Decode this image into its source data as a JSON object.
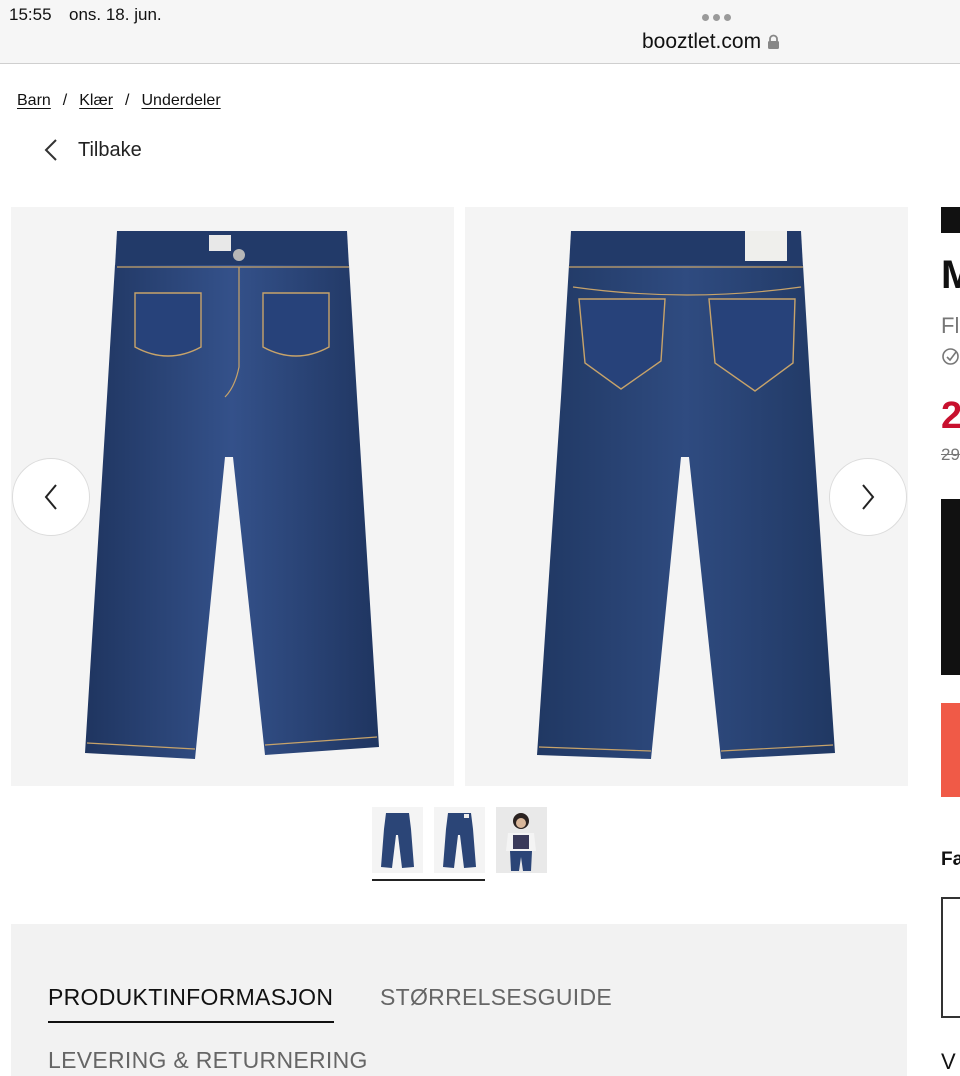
{
  "status_bar": {
    "time": "15:55",
    "date": "ons. 18. jun.",
    "url": "booztlet.com"
  },
  "breadcrumb": {
    "items": [
      "Barn",
      "Klær",
      "Underdeler"
    ],
    "separator": "/"
  },
  "back": {
    "label": "Tilbake"
  },
  "gallery": {
    "images": [
      "jeans-front",
      "jeans-back"
    ],
    "thumbnails": [
      "jeans-front-thumb",
      "jeans-back-thumb",
      "model-thumb"
    ],
    "prev_icon": "chevron-left-icon",
    "next_icon": "chevron-right-icon"
  },
  "info_tabs": {
    "produkt": "PRODUKTINFORMASJON",
    "storrelse": "STØRRELSESGUIDE",
    "levering": "LEVERING & RETURNERING"
  },
  "product_panel_clipped": {
    "title_visible": "M",
    "subtitle_visible": "Fl",
    "price_visible": "2",
    "old_price_visible": "29",
    "section_visible": "Fa",
    "bottom_visible": "V"
  },
  "colors": {
    "denim": "#2b4577",
    "denim_dark": "#1f3560",
    "stitch": "#c7a36a",
    "price_red": "#c8102e",
    "cta_coral": "#f05a47",
    "panel_bg": "#f4f4f4"
  }
}
